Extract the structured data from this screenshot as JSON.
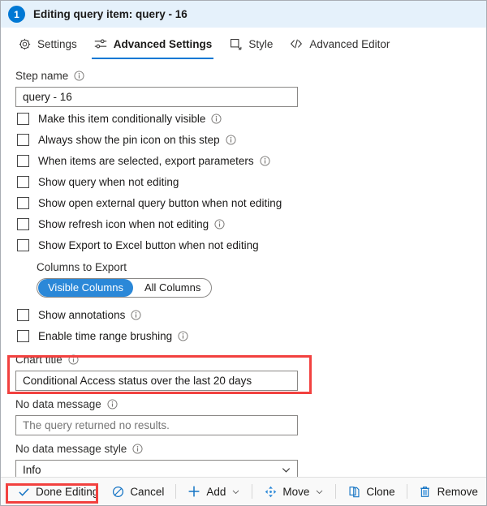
{
  "header": {
    "step_number": "1",
    "title": "Editing query item: query - 16",
    "badge_color": "#0078d4",
    "background_color": "#e5f1fb"
  },
  "tabs": [
    {
      "label": "Settings",
      "icon": "gear-icon",
      "active": false
    },
    {
      "label": "Advanced Settings",
      "icon": "sliders-icon",
      "active": true
    },
    {
      "label": "Style",
      "icon": "style-square-icon",
      "active": false
    },
    {
      "label": "Advanced Editor",
      "icon": "code-brackets-icon",
      "active": false
    }
  ],
  "form": {
    "step_name": {
      "label": "Step name",
      "value": "query - 16",
      "info": true
    },
    "checkboxes": [
      {
        "label": "Make this item conditionally visible",
        "checked": false,
        "info": true
      },
      {
        "label": "Always show the pin icon on this step",
        "checked": false,
        "info": true
      },
      {
        "label": "When items are selected, export parameters",
        "checked": false,
        "info": true
      },
      {
        "label": "Show query when not editing",
        "checked": false,
        "info": false
      },
      {
        "label": "Show open external query button when not editing",
        "checked": false,
        "info": false
      },
      {
        "label": "Show refresh icon when not editing",
        "checked": false,
        "info": true
      },
      {
        "label": "Show Export to Excel button when not editing",
        "checked": false,
        "info": false
      }
    ],
    "columns_to_export": {
      "label": "Columns to Export",
      "options": [
        "Visible Columns",
        "All Columns"
      ],
      "selected": "Visible Columns",
      "selected_color": "#2b88d8"
    },
    "checkboxes2": [
      {
        "label": "Show annotations",
        "checked": false,
        "info": true
      },
      {
        "label": "Enable time range brushing",
        "checked": false,
        "info": true
      }
    ],
    "chart_title": {
      "label": "Chart title",
      "value": "Conditional Access status over the last 20 days",
      "info": true,
      "highlight_color": "#f2413f"
    },
    "no_data_message": {
      "label": "No data message",
      "value": "The query returned no results.",
      "is_placeholder": true,
      "info": true
    },
    "no_data_message_style": {
      "label": "No data message style",
      "value": "Info",
      "info": true
    }
  },
  "toolbar": {
    "done_editing": {
      "label": "Done Editing",
      "icon": "checkmark-icon",
      "highlighted": true
    },
    "cancel": {
      "label": "Cancel",
      "icon": "cancel-circle-icon"
    },
    "add": {
      "label": "Add",
      "icon": "plus-icon",
      "has_caret": true
    },
    "move": {
      "label": "Move",
      "icon": "move-arrows-icon",
      "has_caret": true
    },
    "clone": {
      "label": "Clone",
      "icon": "copy-icon"
    },
    "remove": {
      "label": "Remove",
      "icon": "trash-icon"
    }
  }
}
